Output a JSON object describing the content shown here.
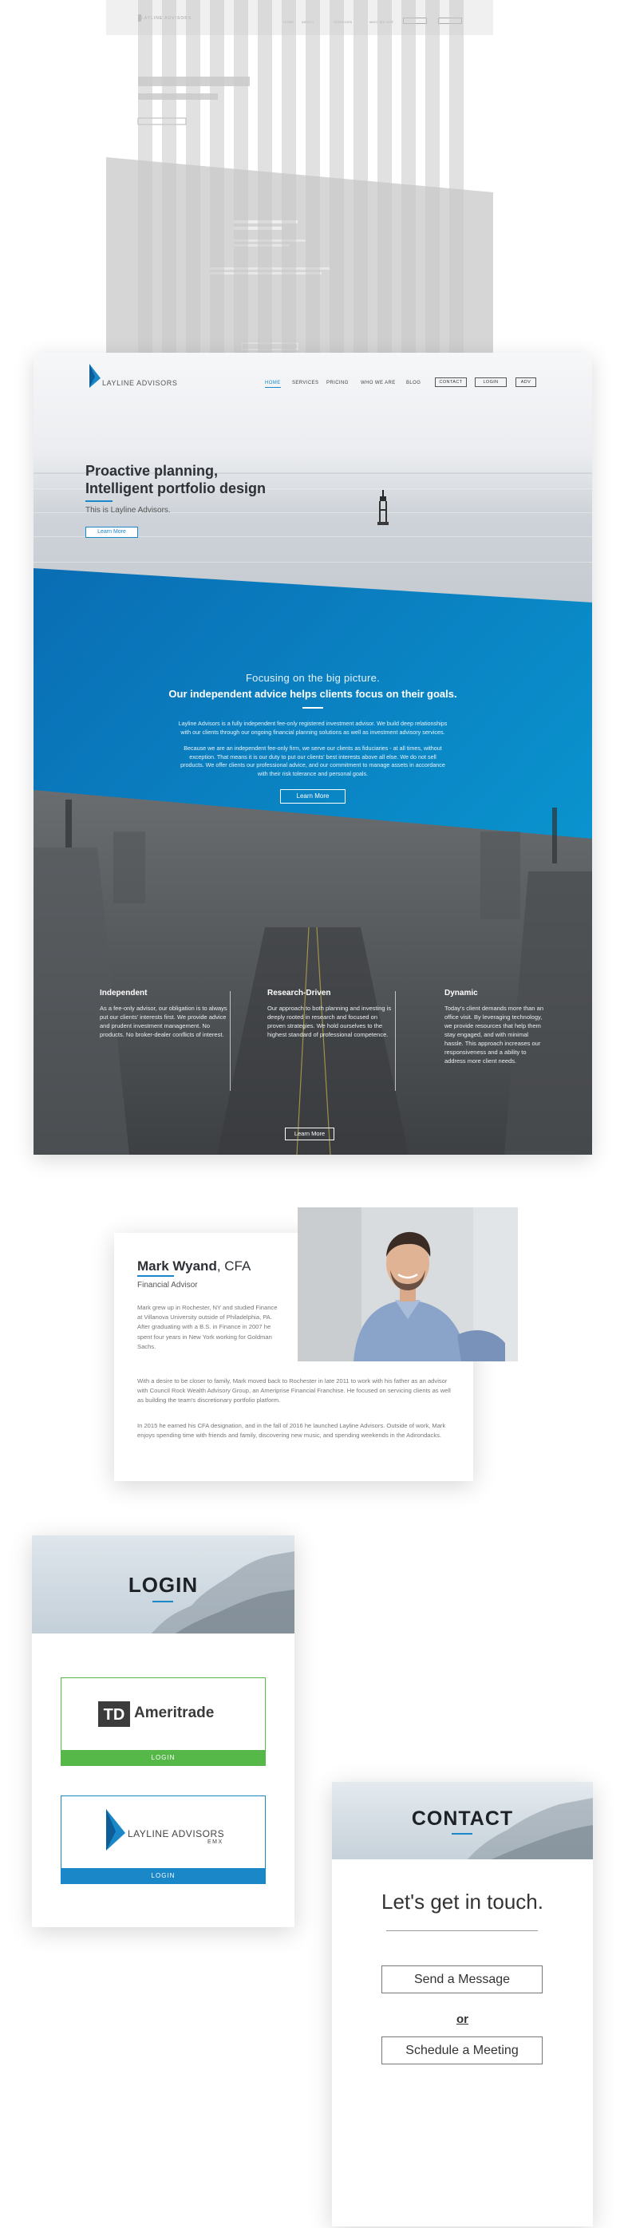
{
  "wireframe": {
    "logo_text": "LAYLINE ADVISORS",
    "nav": [
      "HOME",
      "ABOUT",
      "SERVICES",
      "WHO WE ARE"
    ],
    "buttons": [
      "",
      ""
    ]
  },
  "site": {
    "logo_text": "LAYLINE ADVISORS",
    "nav": [
      {
        "label": "HOME",
        "active": true
      },
      {
        "label": "SERVICES",
        "active": false
      },
      {
        "label": "PRICING",
        "active": false
      },
      {
        "label": "WHO WE ARE",
        "active": false
      },
      {
        "label": "BLOG",
        "active": false
      }
    ],
    "nav_buttons": [
      "CONTACT",
      "LOGIN",
      "ADV"
    ],
    "hero": {
      "title_line1": "Proactive planning,",
      "title_line2": "Intelligent portfolio design",
      "subtitle": "This is Layline Advisors.",
      "button": "Learn More"
    },
    "mission": {
      "heading": "Focusing on the big picture.",
      "subheading": "Our independent advice helps clients focus on their goals.",
      "para1": "Layline Advisors is a fully independent fee-only registered investment advisor. We build deep relationships with our clients through our ongoing financial planning solutions as well as investment advisory services.",
      "para2": "Because we are an independent fee-only firm, we serve our clients as fiduciaries - at all times, without exception. That means it is our duty to put our clients' best interests above all else. We do not sell products. We offer clients our professional advice, and our commitment to manage assets in accordance with their risk tolerance and personal goals.",
      "button": "Learn More"
    },
    "features": [
      {
        "title": "Independent",
        "text": "As a fee-only advisor, our obligation is to always put our clients' interests first. We provide advice and prudent investment management. No products. No broker-dealer conflicts of interest."
      },
      {
        "title": "Research-Driven",
        "text": "Our approach to both planning and investing is deeply rooted in research and focused on proven strategies. We hold ourselves to the highest standard of professional competence."
      },
      {
        "title": "Dynamic",
        "text": "Today's client demands more than an office visit. By leveraging technology, we provide resources that help them stay engaged, and with minimal hassle. This approach increases our responsiveness and a ability to address more client needs."
      }
    ],
    "features_button": "Learn More"
  },
  "bio": {
    "name": "Mark Wyand",
    "credential": ", CFA",
    "role": "Financial Advisor",
    "para1": "Mark grew up in Rochester, NY and studied Finance at Villanova University outside of Philadelphia, PA. After graduating with a B.S. in Finance in 2007 he spent four years in New York working for Goldman Sachs.",
    "para2": "With a desire to be closer to family, Mark moved back to Rochester in late 2011 to work with his father as an advisor with Council Rock Wealth Advisory Group, an Ameriprise Financial Franchise. He focused on servicing clients as well as building the team's discretionary portfolio platform.",
    "para3": "In 2015 he earned his CFA designation, and in the fall of 2016 he launched Layline Advisors. Outside of work, Mark enjoys spending time with friends and family, discovering new music, and spending weekends in the Adirondacks."
  },
  "login": {
    "title": "LOGIN",
    "providers": [
      {
        "name": "Ameritrade",
        "mark": "TD",
        "button": "LOGIN",
        "color": "#55b849"
      },
      {
        "name": "LAYLINE ADVISORS",
        "sub": "EMX",
        "button": "LOGIN",
        "color": "#1a87c9"
      }
    ]
  },
  "contact": {
    "title": "CONTACT",
    "subtitle": "Let's get in touch.",
    "send_button": "Send a Message",
    "or_text": "or",
    "schedule_button": "Schedule a Meeting"
  },
  "colors": {
    "accent": "#1a87c9",
    "accent_light": "#0498d4",
    "ameritrade_green": "#55b849",
    "dark_text": "#2d3136"
  },
  "icons": [
    "layline-sail-logo-icon",
    "channel-marker-icon",
    "td-ameritrade-logo-icon",
    "portrait-photo"
  ]
}
